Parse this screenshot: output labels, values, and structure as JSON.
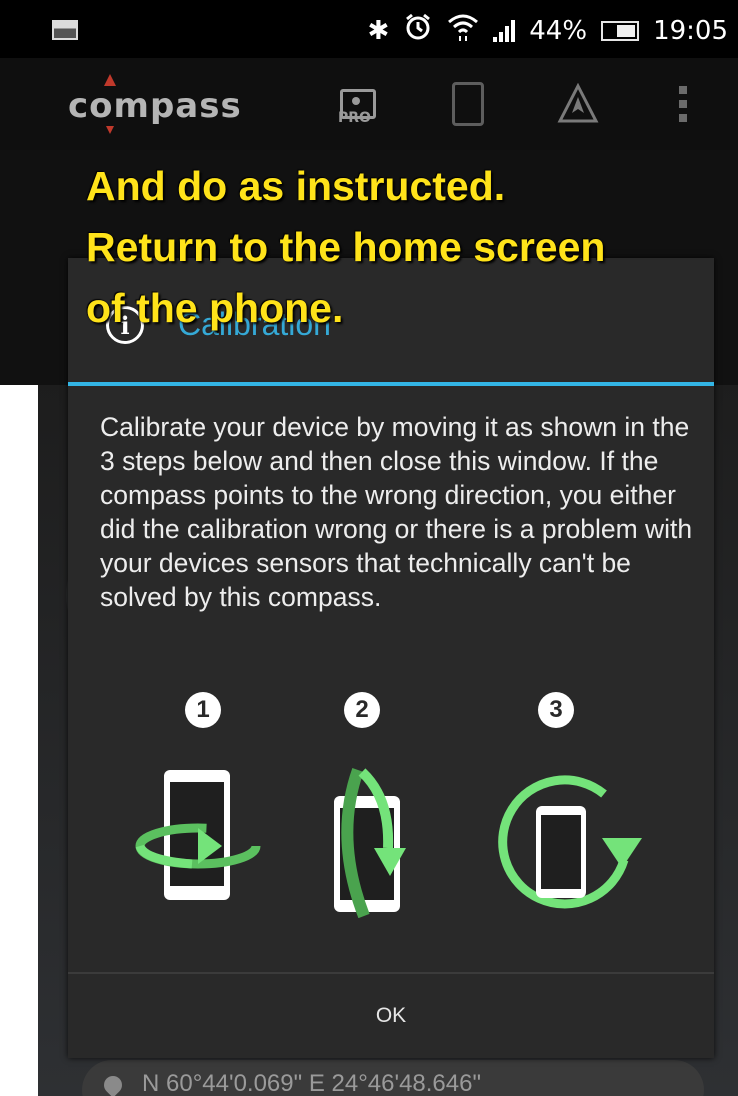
{
  "status_bar": {
    "battery_percent": "44%",
    "time": "19:05",
    "icons": [
      "image-notification-icon",
      "bluetooth-icon",
      "alarm-icon",
      "wifi-icon",
      "signal-icon",
      "battery-icon"
    ]
  },
  "action_bar": {
    "logo_text": "compass",
    "pro_label": "PRO",
    "icons": [
      "pro-icon",
      "rotate-screen-icon",
      "navigation-icon",
      "overflow-menu-icon"
    ]
  },
  "caption": {
    "line1": "And do as instructed.",
    "line2": "Return to the home screen",
    "line3": "of the phone."
  },
  "dialog": {
    "title": "Calibration",
    "body": "Calibrate your device by moving it as shown in the 3 steps below and then close this window. If the compass points to the wrong direction, you either did the calibration wrong or there is a problem with your devices sensors that technically can't be solved by this compass.",
    "steps": [
      {
        "number": "1",
        "icon": "rotate-horizontal-icon"
      },
      {
        "number": "2",
        "icon": "rotate-vertical-icon"
      },
      {
        "number": "3",
        "icon": "rotate-flat-icon"
      }
    ],
    "ok_label": "OK"
  },
  "coordinates": {
    "text": "N 60°44'0.069\" E 24°46'48.646\""
  },
  "colors": {
    "caption": "#ffe31a",
    "dialog_title": "#35a9d6",
    "accent_rule": "#33b5e5",
    "arrow_green": "#74e37a"
  }
}
